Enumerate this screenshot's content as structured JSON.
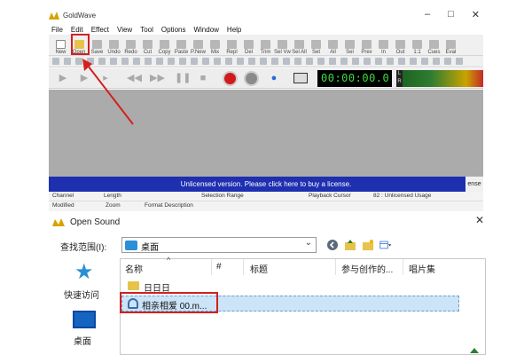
{
  "app": {
    "title": "GoldWave",
    "menu": [
      "File",
      "Edit",
      "Effect",
      "View",
      "Tool",
      "Options",
      "Window",
      "Help"
    ]
  },
  "toolbar": {
    "buttons": [
      "New",
      "Open",
      "Save",
      "Undo",
      "Redo",
      "Cut",
      "Copy",
      "Paste",
      "P.New",
      "Mix",
      "Repl",
      "Del",
      "Trim",
      "Sel Vw",
      "Sel All",
      "Set",
      "All",
      "Sel",
      "Prev",
      "In",
      "Out",
      "1:1",
      "Cues",
      "Eval"
    ]
  },
  "transport": {
    "timer": "00:00:00.0",
    "meter_l": "L",
    "meter_r": "R"
  },
  "banner": {
    "text": "Unlicensed version. Please click here to buy a license.",
    "right": "ense"
  },
  "status": {
    "row1": [
      "Channel",
      "Length",
      "Selection Range",
      "Playback Cursor",
      "82 : Unlicensed Usage"
    ],
    "row2": [
      "Modified",
      "Zoom",
      "Format Description"
    ]
  },
  "dialog": {
    "title": "Open Sound",
    "close": "✕",
    "look_in_label": "查找范围(I):",
    "look_in_value": "桌面",
    "places": [
      "快速访问",
      "桌面"
    ],
    "columns": [
      "名称",
      "#",
      "标题",
      "参与创作的...",
      "唱片集"
    ],
    "files": [
      {
        "name": "日日日"
      },
      {
        "name": "相亲相爱 00.m..."
      }
    ]
  },
  "colors": {
    "banner": "#1e2fb0",
    "annotation": "#d32020",
    "timer_text": "#3ddc3d",
    "selection": "#cce4f7"
  }
}
